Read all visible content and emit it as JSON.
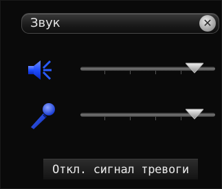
{
  "panel": {
    "title": "Звук",
    "close_icon": "close-icon"
  },
  "speaker": {
    "icon": "speaker-volume-icon",
    "volume_level": 0.9
  },
  "microphone": {
    "icon": "microphone-icon",
    "volume_level": 0.9
  },
  "alarm_button": {
    "label": "Откл. сигнал тревоги"
  },
  "colors": {
    "accent": "#1e4dff",
    "background": "#0a0a0a"
  }
}
